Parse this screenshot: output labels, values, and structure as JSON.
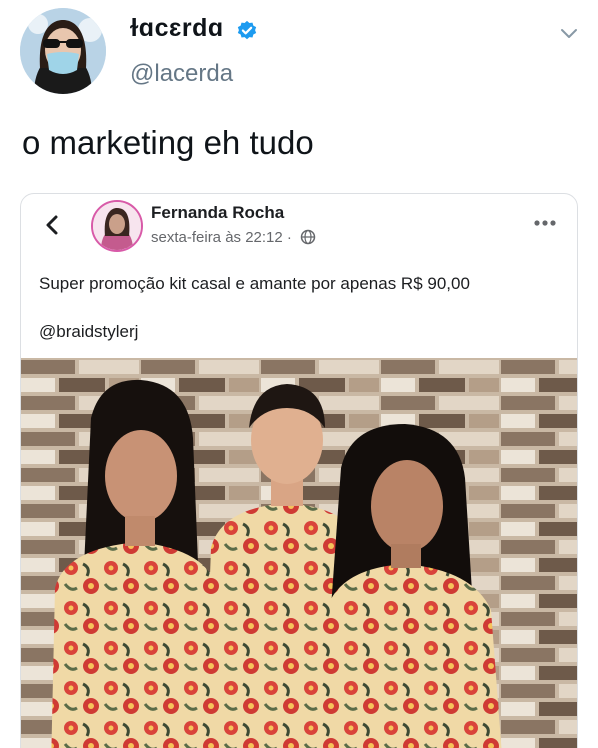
{
  "tweet": {
    "display_name": "ɫɑcɛrdɑ",
    "handle": "@lacerda",
    "text": "o marketing eh tudo",
    "icons": {
      "verified": "verified-badge-icon",
      "menu": "chevron-down-icon"
    },
    "colors": {
      "verified": "#1d9bf0",
      "handle": "#657786"
    }
  },
  "embedded_post": {
    "author": "Fernanda Rocha",
    "timestamp": "sexta-feira às 22:12",
    "separator": "·",
    "text": "Super promoção kit casal e amante por apenas R$ 90,00",
    "tag": "@braidstylerj",
    "icons": {
      "back": "chevron-left-icon",
      "audience": "globe-icon",
      "more": "more-options-icon"
    },
    "photo": {
      "description_kind": "photo of three people in matching floral shirts"
    }
  }
}
